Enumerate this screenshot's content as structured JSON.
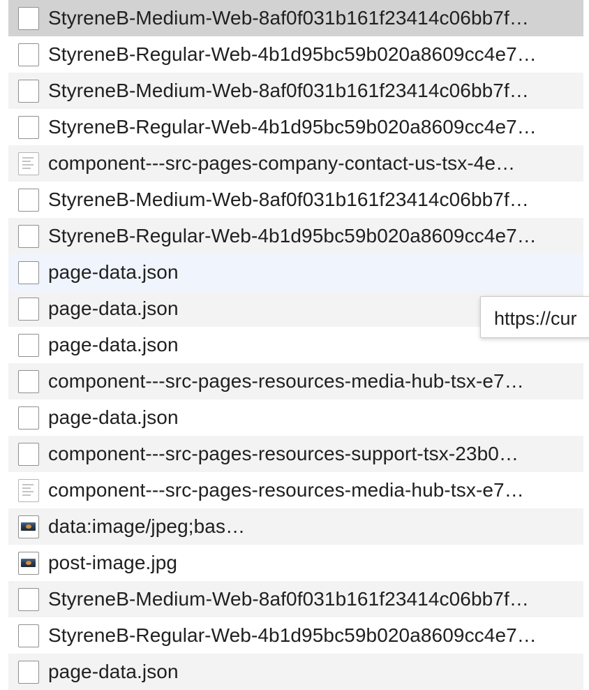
{
  "network_list": {
    "rows": [
      {
        "name": "StyreneB-Medium-Web-8af0f031b161f23414c06bb7f…",
        "icon": "font-file-icon",
        "state": "selected"
      },
      {
        "name": "StyreneB-Regular-Web-4b1d95bc59b020a8609cc4e7…",
        "icon": "font-file-icon",
        "state": ""
      },
      {
        "name": "StyreneB-Medium-Web-8af0f031b161f23414c06bb7f…",
        "icon": "font-file-icon",
        "state": ""
      },
      {
        "name": "StyreneB-Regular-Web-4b1d95bc59b020a8609cc4e7…",
        "icon": "font-file-icon",
        "state": ""
      },
      {
        "name": "component---src-pages-company-contact-us-tsx-4e…",
        "icon": "script-file-icon",
        "state": ""
      },
      {
        "name": "StyreneB-Medium-Web-8af0f031b161f23414c06bb7f…",
        "icon": "font-file-icon",
        "state": ""
      },
      {
        "name": "StyreneB-Regular-Web-4b1d95bc59b020a8609cc4e7…",
        "icon": "font-file-icon",
        "state": ""
      },
      {
        "name": "page-data.json",
        "icon": "data-file-icon",
        "state": "hovered"
      },
      {
        "name": "page-data.json",
        "icon": "data-file-icon",
        "state": ""
      },
      {
        "name": "page-data.json",
        "icon": "data-file-icon",
        "state": ""
      },
      {
        "name": "component---src-pages-resources-media-hub-tsx-e7…",
        "icon": "data-file-icon",
        "state": ""
      },
      {
        "name": "page-data.json",
        "icon": "data-file-icon",
        "state": ""
      },
      {
        "name": "component---src-pages-resources-support-tsx-23b0…",
        "icon": "data-file-icon",
        "state": ""
      },
      {
        "name": "component---src-pages-resources-media-hub-tsx-e7…",
        "icon": "script-file-icon",
        "state": ""
      },
      {
        "name": "data:image/jpeg;bas…",
        "icon": "image-file-icon",
        "state": ""
      },
      {
        "name": "post-image.jpg",
        "icon": "image-file-icon",
        "state": ""
      },
      {
        "name": "StyreneB-Medium-Web-8af0f031b161f23414c06bb7f…",
        "icon": "font-file-icon",
        "state": ""
      },
      {
        "name": "StyreneB-Regular-Web-4b1d95bc59b020a8609cc4e7…",
        "icon": "font-file-icon",
        "state": ""
      },
      {
        "name": "page-data.json",
        "icon": "data-file-icon",
        "state": ""
      }
    ]
  },
  "tooltip": {
    "text": "https://cur"
  },
  "colors": {
    "row_even": "#f3f3f3",
    "row_odd": "#ffffff",
    "row_selected": "#d2d2d2",
    "row_hovered": "#eff4fd",
    "text": "#202020"
  }
}
